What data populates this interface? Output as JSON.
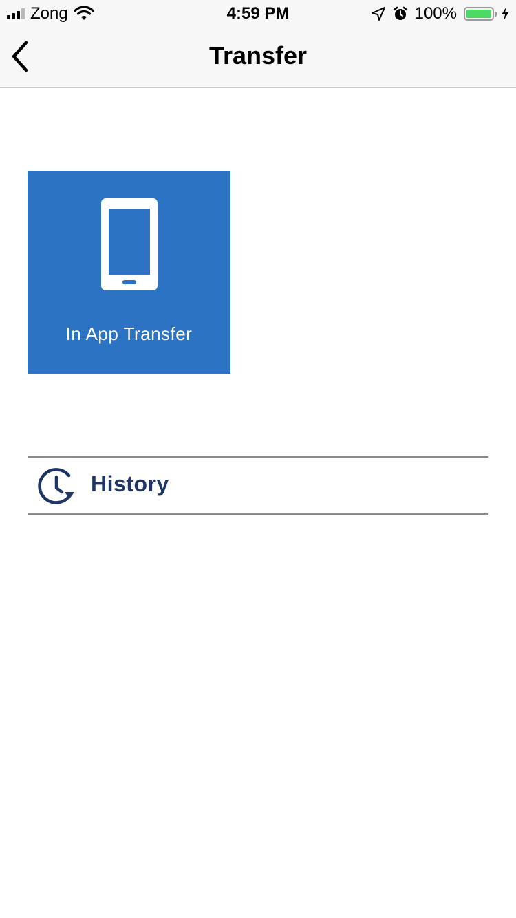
{
  "status_bar": {
    "carrier": "Zong",
    "time": "4:59 PM",
    "battery_percent": "100%",
    "battery_level": 1.0,
    "battery_color": "#4cd964",
    "icons": [
      "signal-icon",
      "wifi-icon",
      "location-arrow-icon",
      "alarm-icon",
      "battery-icon",
      "charging-bolt-icon"
    ]
  },
  "nav": {
    "title": "Transfer",
    "back_icon": "chevron-left-icon"
  },
  "tiles": [
    {
      "label": "In App Transfer",
      "icon": "smartphone-icon",
      "background": "#2c73c4"
    }
  ],
  "history": {
    "label": "History",
    "icon": "history-clock-icon",
    "color": "#1f3566"
  }
}
